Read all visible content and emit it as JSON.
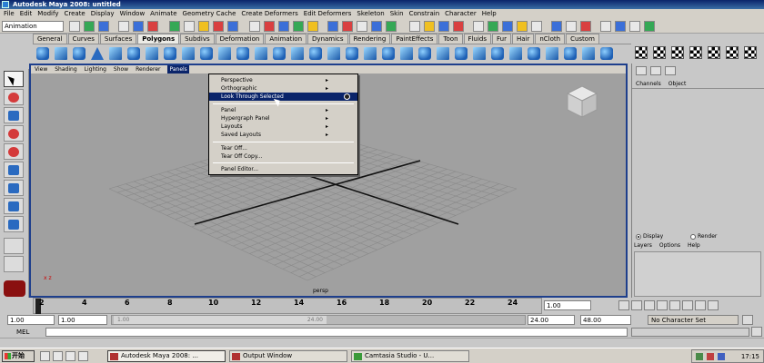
{
  "window": {
    "title": "Autodesk Maya 2008: untitled"
  },
  "main_menu": [
    "File",
    "Edit",
    "Modify",
    "Create",
    "Display",
    "Window",
    "Animate",
    "Geometry Cache",
    "Create Deformers",
    "Edit Deformers",
    "Skeleton",
    "Skin",
    "Constrain",
    "Character",
    "Help"
  ],
  "status_line": {
    "mode": "Animation"
  },
  "shelf_tabs": [
    "General",
    "Curves",
    "Surfaces",
    "Polygons",
    "Subdivs",
    "Deformation",
    "Animation",
    "Dynamics",
    "Rendering",
    "PaintEffects",
    "Toon",
    "Fluids",
    "Fur",
    "Hair",
    "nCloth",
    "Custom"
  ],
  "shelf_active_tab": "Polygons",
  "panel_menu": [
    "View",
    "Shading",
    "Lighting",
    "Show",
    "Renderer",
    "Panels"
  ],
  "panel_menu_active": "Panels",
  "panels_dropdown": {
    "items": [
      {
        "label": "Perspective",
        "submenu": true
      },
      {
        "label": "Orthographic",
        "submenu": true
      },
      {
        "label": "Look Through Selected",
        "highlighted": true,
        "option_box": true
      },
      {
        "label": "Panel",
        "submenu": true
      },
      {
        "label": "Hypergraph Panel",
        "submenu": true
      },
      {
        "label": "Layouts",
        "submenu": true
      },
      {
        "label": "Saved Layouts",
        "submenu": true
      },
      {
        "label": "Tear Off..."
      },
      {
        "label": "Tear Off Copy..."
      },
      {
        "label": "Panel Editor..."
      }
    ]
  },
  "viewport": {
    "camera_label": "persp",
    "axis_label": "x z"
  },
  "channel_box": {
    "header": [
      "Channels",
      "Object"
    ],
    "layer_modes": [
      "Display",
      "Render"
    ],
    "layer_mode_selected": "Display",
    "layer_menu": [
      "Layers",
      "Options",
      "Help"
    ]
  },
  "time_slider": {
    "ticks": [
      "2",
      "4",
      "6",
      "8",
      "10",
      "12",
      "14",
      "16",
      "18",
      "20",
      "22",
      "24"
    ],
    "current_frame": "1.00"
  },
  "range_slider": {
    "start_time": "1.00",
    "playback_start": "1.00",
    "range_start_label": "1.00",
    "range_end_label": "24.00",
    "playback_end": "24.00",
    "end_time": "48.00",
    "character_set": "No Character Set"
  },
  "command_line": {
    "label": "MEL"
  },
  "taskbar": {
    "start_label": "开始",
    "tasks": [
      {
        "label": "Autodesk Maya 2008: ...",
        "active": true
      },
      {
        "label": "Output Window",
        "active": false
      },
      {
        "label": "Camtasia Studio - U...",
        "active": false
      }
    ],
    "clock": "17:15"
  }
}
